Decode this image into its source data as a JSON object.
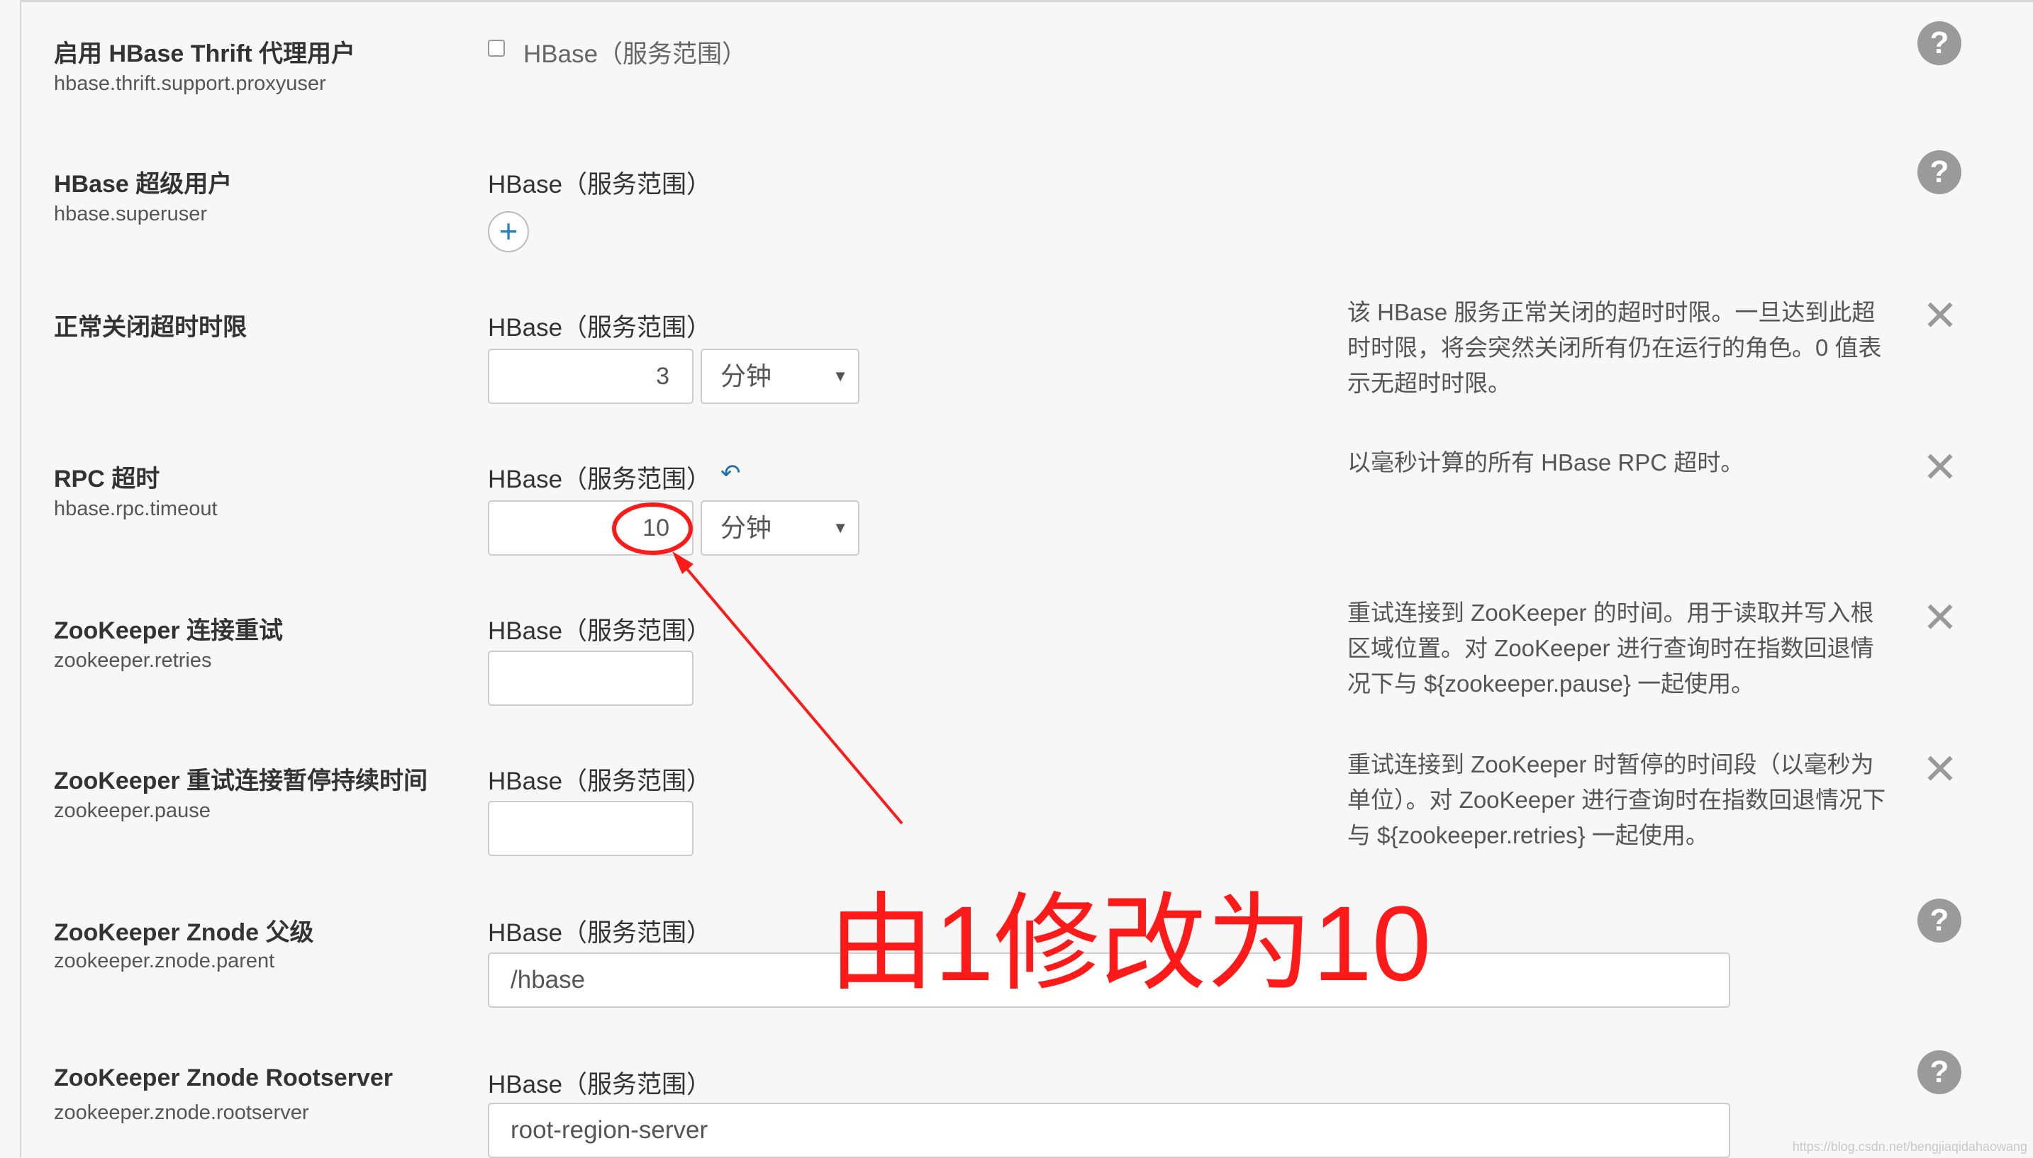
{
  "settings": [
    {
      "name": "启用 HBase Thrift 代理用户",
      "key": "hbase.thrift.support.proxyuser",
      "checkbox_label": "HBase（服务范围）"
    },
    {
      "name": "HBase 超级用户",
      "key": "hbase.superuser",
      "scope": "HBase（服务范围）",
      "add_button": "+"
    },
    {
      "name": "正常关闭超时时限",
      "scope": "HBase（服务范围）",
      "value": "3",
      "unit": "分钟",
      "description": "该 HBase 服务正常关闭的超时时限。一旦达到此超时时限，将会突然关闭所有仍在运行的角色。0 值表示无超时时限。"
    },
    {
      "name": "RPC 超时",
      "key": "hbase.rpc.timeout",
      "scope": "HBase（服务范围）",
      "value": "10",
      "unit": "分钟",
      "description": "以毫秒计算的所有 HBase RPC 超时。"
    },
    {
      "name": "ZooKeeper 连接重试",
      "key": "zookeeper.retries",
      "scope": "HBase（服务范围）",
      "value": "",
      "description": "重试连接到 ZooKeeper 的时间。用于读取并写入根区域位置。对 ZooKeeper 进行查询时在指数回退情况下与 ${zookeeper.pause} 一起使用。"
    },
    {
      "name": "ZooKeeper 重试连接暂停持续时间",
      "key": "zookeeper.pause",
      "scope": "HBase（服务范围）",
      "value": "",
      "description": "重试连接到 ZooKeeper 时暂停的时间段（以毫秒为单位）。对 ZooKeeper 进行查询时在指数回退情况下与 ${zookeeper.retries} 一起使用。"
    },
    {
      "name": "ZooKeeper Znode 父级",
      "key": "zookeeper.znode.parent",
      "scope": "HBase（服务范围）",
      "value": "/hbase"
    },
    {
      "name": "ZooKeeper Znode Rootserver",
      "key": "zookeeper.znode.rootserver",
      "scope": "HBase（服务范围）",
      "value": "root-region-server"
    }
  ],
  "icons": {
    "help": "?",
    "close": "✕",
    "undo": "↶",
    "caret": "▼"
  },
  "annotation": {
    "text": "由1修改为10",
    "color": "#ff1a1a"
  },
  "watermark": "https://blog.csdn.net/bengjiaqidahaowang"
}
